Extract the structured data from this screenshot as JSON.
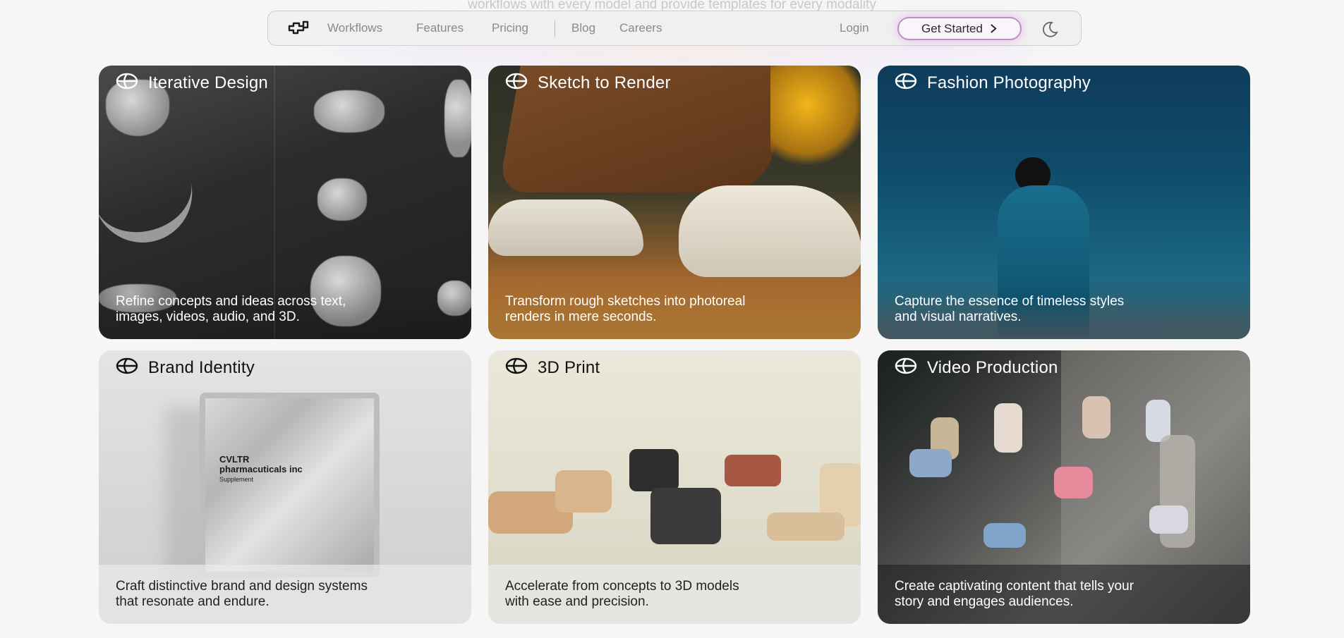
{
  "background_text": "workflows with every model and provide templates for every modality",
  "nav": {
    "links": [
      "Workflows",
      "Features",
      "Pricing"
    ],
    "secondary_links": [
      "Blog",
      "Careers"
    ],
    "login_label": "Login",
    "cta_label": "Get Started",
    "cta_icon": "chevron-right-icon",
    "theme_icon": "moon-icon",
    "logo_icon": "brand-logo-icon"
  },
  "cards": [
    {
      "title": "Iterative Design",
      "desc_line1": "Refine concepts and ideas across text,",
      "desc_line2": "images, videos, audio, and 3D."
    },
    {
      "title": "Sketch to Render",
      "desc_line1": "Transform rough sketches into photoreal",
      "desc_line2": "renders in mere seconds."
    },
    {
      "title": "Fashion Photography",
      "desc_line1": "Capture the essence of timeless styles",
      "desc_line2": "and visual narratives."
    },
    {
      "title": "Brand Identity",
      "desc_line1": "Craft distinctive brand and design systems",
      "desc_line2": "that resonate and endure."
    },
    {
      "title": "3D Print",
      "desc_line1": "Accelerate from concepts to 3D models",
      "desc_line2": "with ease and precision."
    },
    {
      "title": "Video Production",
      "desc_line1": "Create captivating content that tells your",
      "desc_line2": "story and engages audiences."
    }
  ],
  "card_icon": "globe-icon",
  "packaging_text": {
    "brand": "CVLTR",
    "company": "pharmacuticals inc",
    "type": "Supplement"
  },
  "colors": {
    "cta_border": "#c38ec8",
    "page_bg": "#f6f6f6"
  }
}
